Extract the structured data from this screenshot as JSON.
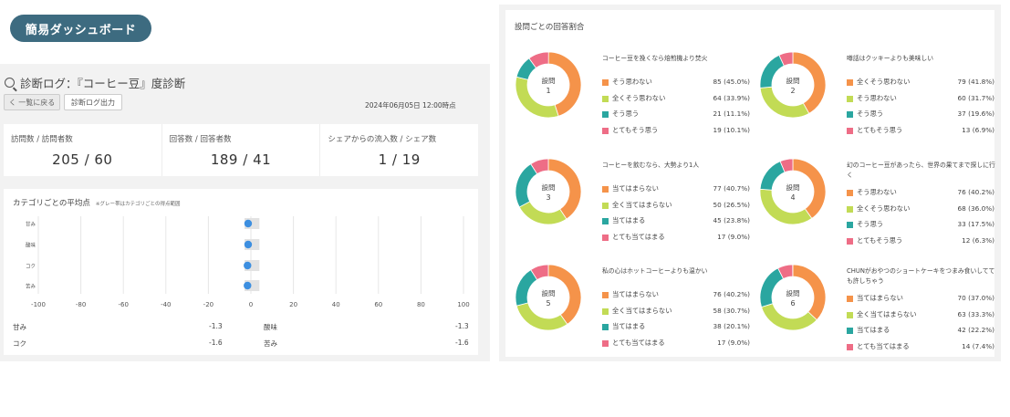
{
  "header": {
    "badge": "簡易ダッシュボード"
  },
  "colors": {
    "orange": "#f5934a",
    "lime": "#c2db55",
    "teal": "#2aa6a0",
    "pink": "#ee6d86",
    "dot": "#3d8fe0",
    "badge": "#3d6b80"
  },
  "log": {
    "title": "診断ログ：『コーヒー豆』度診断",
    "back_label": "く 一覧に戻る",
    "export_label": "診断ログ出力",
    "timestamp": "2024年06月05日 12:00時点"
  },
  "stats": [
    {
      "label": "訪問数 / 訪問者数",
      "value": "205 / 60"
    },
    {
      "label": "回答数 / 回答者数",
      "value": "189 / 41"
    },
    {
      "label": "シェアからの流入数 / シェア数",
      "value": "1 / 19"
    }
  ],
  "category": {
    "title": "カテゴリごとの平均点",
    "note": "※グレー帯はカテゴリごとの得点範囲",
    "chart_data": {
      "type": "scatter",
      "categories": [
        "甘み",
        "酸味",
        "コク",
        "苦み"
      ],
      "values": [
        -1.3,
        -1.3,
        -1.6,
        -1.6
      ],
      "range_bands": [
        [
          -3,
          4
        ],
        [
          -3,
          4
        ],
        [
          -3,
          4
        ],
        [
          -3,
          4
        ]
      ],
      "xlim": [
        -100,
        100
      ],
      "xticks": [
        "-100",
        "-80",
        "-60",
        "-40",
        "-20",
        "0",
        "20",
        "40",
        "60",
        "80",
        "100"
      ]
    },
    "table": [
      {
        "label": "甘み",
        "value": "-1.3",
        "label2": "酸味",
        "value2": "-1.3"
      },
      {
        "label": "コク",
        "value": "-1.6",
        "label2": "苦み",
        "value2": "-1.6"
      }
    ]
  },
  "questions": {
    "header": "設問ごとの回答割合",
    "center_label": "設問",
    "items": [
      {
        "number": "1",
        "title": "コーヒー豆を挽くなら焙煎機より焚火",
        "answers": [
          {
            "label": "そう思わない",
            "value": "85 (45.0%)",
            "pct": 45.0,
            "color": "#f5934a"
          },
          {
            "label": "全くそう思わない",
            "value": "64 (33.9%)",
            "pct": 33.9,
            "color": "#c2db55"
          },
          {
            "label": "そう思う",
            "value": "21 (11.1%)",
            "pct": 11.1,
            "color": "#2aa6a0"
          },
          {
            "label": "とてもそう思う",
            "value": "19 (10.1%)",
            "pct": 10.1,
            "color": "#ee6d86"
          }
        ]
      },
      {
        "number": "2",
        "title": "噂話はクッキーよりも美味しい",
        "answers": [
          {
            "label": "全くそう思わない",
            "value": "79 (41.8%)",
            "pct": 41.8,
            "color": "#f5934a"
          },
          {
            "label": "そう思わない",
            "value": "60 (31.7%)",
            "pct": 31.7,
            "color": "#c2db55"
          },
          {
            "label": "そう思う",
            "value": "37 (19.6%)",
            "pct": 19.6,
            "color": "#2aa6a0"
          },
          {
            "label": "とてもそう思う",
            "value": "13 (6.9%)",
            "pct": 6.9,
            "color": "#ee6d86"
          }
        ]
      },
      {
        "number": "3",
        "title": "コーヒーを飲むなら、大勢より1人",
        "answers": [
          {
            "label": "当てはまらない",
            "value": "77 (40.7%)",
            "pct": 40.7,
            "color": "#f5934a"
          },
          {
            "label": "全く当てはまらない",
            "value": "50 (26.5%)",
            "pct": 26.5,
            "color": "#c2db55"
          },
          {
            "label": "当てはまる",
            "value": "45 (23.8%)",
            "pct": 23.8,
            "color": "#2aa6a0"
          },
          {
            "label": "とても当てはまる",
            "value": "17 (9.0%)",
            "pct": 9.0,
            "color": "#ee6d86"
          }
        ]
      },
      {
        "number": "4",
        "title": "幻のコーヒー豆があったら、世界の果てまで探しに行く",
        "answers": [
          {
            "label": "そう思わない",
            "value": "76 (40.2%)",
            "pct": 40.2,
            "color": "#f5934a"
          },
          {
            "label": "全くそう思わない",
            "value": "68 (36.0%)",
            "pct": 36.0,
            "color": "#c2db55"
          },
          {
            "label": "そう思う",
            "value": "33 (17.5%)",
            "pct": 17.5,
            "color": "#2aa6a0"
          },
          {
            "label": "とてもそう思う",
            "value": "12 (6.3%)",
            "pct": 6.3,
            "color": "#ee6d86"
          }
        ]
      },
      {
        "number": "5",
        "title": "私の心はホットコーヒーよりも温かい",
        "answers": [
          {
            "label": "当てはまらない",
            "value": "76 (40.2%)",
            "pct": 40.2,
            "color": "#f5934a"
          },
          {
            "label": "全く当てはまらない",
            "value": "58 (30.7%)",
            "pct": 30.7,
            "color": "#c2db55"
          },
          {
            "label": "当てはまる",
            "value": "38 (20.1%)",
            "pct": 20.1,
            "color": "#2aa6a0"
          },
          {
            "label": "とても当てはまる",
            "value": "17 (9.0%)",
            "pct": 9.0,
            "color": "#ee6d86"
          }
        ]
      },
      {
        "number": "6",
        "title": "CHUNがおやつのショートケーキをつまみ食いしてても許しちゃう",
        "answers": [
          {
            "label": "当てはまらない",
            "value": "70 (37.0%)",
            "pct": 37.0,
            "color": "#f5934a"
          },
          {
            "label": "全く当てはまらない",
            "value": "63 (33.3%)",
            "pct": 33.3,
            "color": "#c2db55"
          },
          {
            "label": "当てはまる",
            "value": "42 (22.2%)",
            "pct": 22.2,
            "color": "#2aa6a0"
          },
          {
            "label": "とても当てはまる",
            "value": "14 (7.4%)",
            "pct": 7.4,
            "color": "#ee6d86"
          }
        ]
      }
    ]
  }
}
